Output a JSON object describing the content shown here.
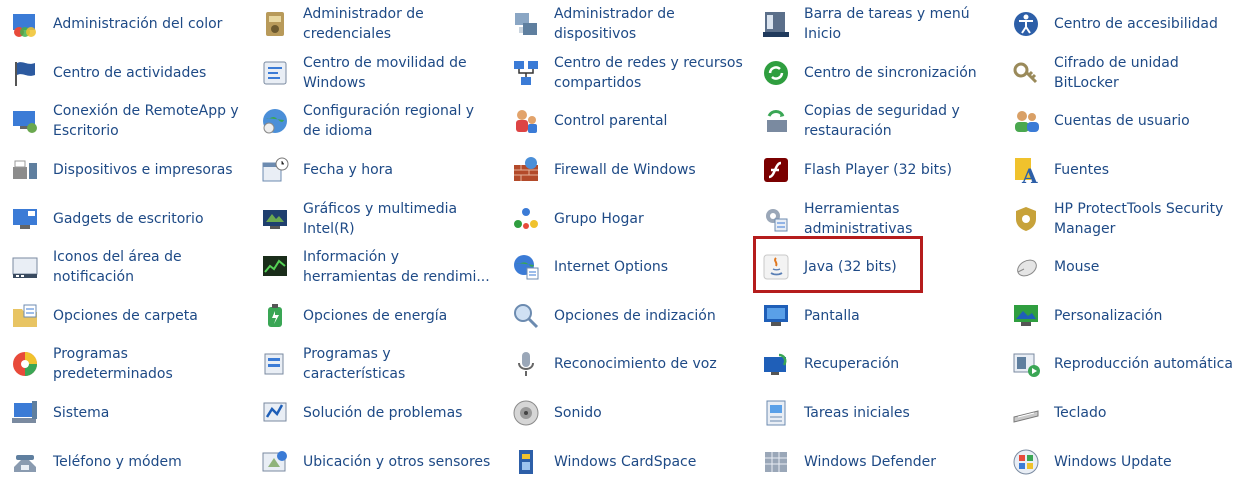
{
  "items": [
    {
      "label": "Administración del color",
      "icon": "color-management-icon"
    },
    {
      "label": "Administrador de credenciales",
      "icon": "credential-manager-icon"
    },
    {
      "label": "Administrador de dispositivos",
      "icon": "device-manager-icon"
    },
    {
      "label": "Barra de tareas y menú Inicio",
      "icon": "taskbar-icon"
    },
    {
      "label": "Centro de accesibilidad",
      "icon": "accessibility-icon"
    },
    {
      "label": "Centro de actividades",
      "icon": "action-center-flag-icon"
    },
    {
      "label": "Centro de movilidad de Windows",
      "icon": "mobility-center-icon"
    },
    {
      "label": "Centro de redes y recursos compartidos",
      "icon": "network-center-icon"
    },
    {
      "label": "Centro de sincronización",
      "icon": "sync-center-icon"
    },
    {
      "label": "Cifrado de unidad BitLocker",
      "icon": "bitlocker-key-icon"
    },
    {
      "label": "Conexión de RemoteApp y Escritorio",
      "icon": "remoteapp-icon"
    },
    {
      "label": "Configuración regional y de idioma",
      "icon": "region-language-icon"
    },
    {
      "label": "Control parental",
      "icon": "parental-control-icon"
    },
    {
      "label": "Copias de seguridad y restauración",
      "icon": "backup-restore-icon"
    },
    {
      "label": "Cuentas de usuario",
      "icon": "user-accounts-icon"
    },
    {
      "label": "Dispositivos e impresoras",
      "icon": "devices-printers-icon"
    },
    {
      "label": "Fecha y hora",
      "icon": "date-time-icon"
    },
    {
      "label": "Firewall de Windows",
      "icon": "firewall-icon"
    },
    {
      "label": "Flash Player (32 bits)",
      "icon": "flash-player-icon"
    },
    {
      "label": "Fuentes",
      "icon": "fonts-icon"
    },
    {
      "label": "Gadgets de escritorio",
      "icon": "desktop-gadgets-icon"
    },
    {
      "label": "Gráficos y multimedia Intel(R)",
      "icon": "intel-graphics-icon"
    },
    {
      "label": "Grupo Hogar",
      "icon": "homegroup-icon"
    },
    {
      "label": "Herramientas administrativas",
      "icon": "admin-tools-icon"
    },
    {
      "label": "HP ProtectTools Security Manager",
      "icon": "hp-security-icon"
    },
    {
      "label": "Iconos del área de notificación",
      "icon": "notification-area-icon"
    },
    {
      "label": "Información y herramientas de rendimi...",
      "icon": "performance-info-icon"
    },
    {
      "label": "Internet Options",
      "icon": "internet-options-icon"
    },
    {
      "label": "Java (32 bits)",
      "icon": "java-icon"
    },
    {
      "label": "Mouse",
      "icon": "mouse-icon"
    },
    {
      "label": "Opciones de carpeta",
      "icon": "folder-options-icon"
    },
    {
      "label": "Opciones de energía",
      "icon": "power-options-icon"
    },
    {
      "label": "Opciones de indización",
      "icon": "indexing-options-icon"
    },
    {
      "label": "Pantalla",
      "icon": "display-icon"
    },
    {
      "label": "Personalización",
      "icon": "personalization-icon"
    },
    {
      "label": "Programas predeterminados",
      "icon": "default-programs-icon"
    },
    {
      "label": "Programas y características",
      "icon": "programs-features-icon"
    },
    {
      "label": "Reconocimiento de voz",
      "icon": "microphone-icon"
    },
    {
      "label": "Recuperación",
      "icon": "recovery-icon"
    },
    {
      "label": "Reproducción automática",
      "icon": "autoplay-icon"
    },
    {
      "label": "Sistema",
      "icon": "system-icon"
    },
    {
      "label": "Solución de problemas",
      "icon": "troubleshooting-icon"
    },
    {
      "label": "Sonido",
      "icon": "sound-icon"
    },
    {
      "label": "Tareas iniciales",
      "icon": "getting-started-icon"
    },
    {
      "label": "Teclado",
      "icon": "keyboard-icon"
    },
    {
      "label": "Teléfono y módem",
      "icon": "phone-modem-icon"
    },
    {
      "label": "Ubicación y otros sensores",
      "icon": "location-sensors-icon"
    },
    {
      "label": "Windows CardSpace",
      "icon": "cardspace-icon"
    },
    {
      "label": "Windows Defender",
      "icon": "windows-defender-icon"
    },
    {
      "label": "Windows Update",
      "icon": "windows-update-icon"
    }
  ],
  "colors": {
    "link": "#1e4a86",
    "highlight_border": "#b51c1c"
  }
}
